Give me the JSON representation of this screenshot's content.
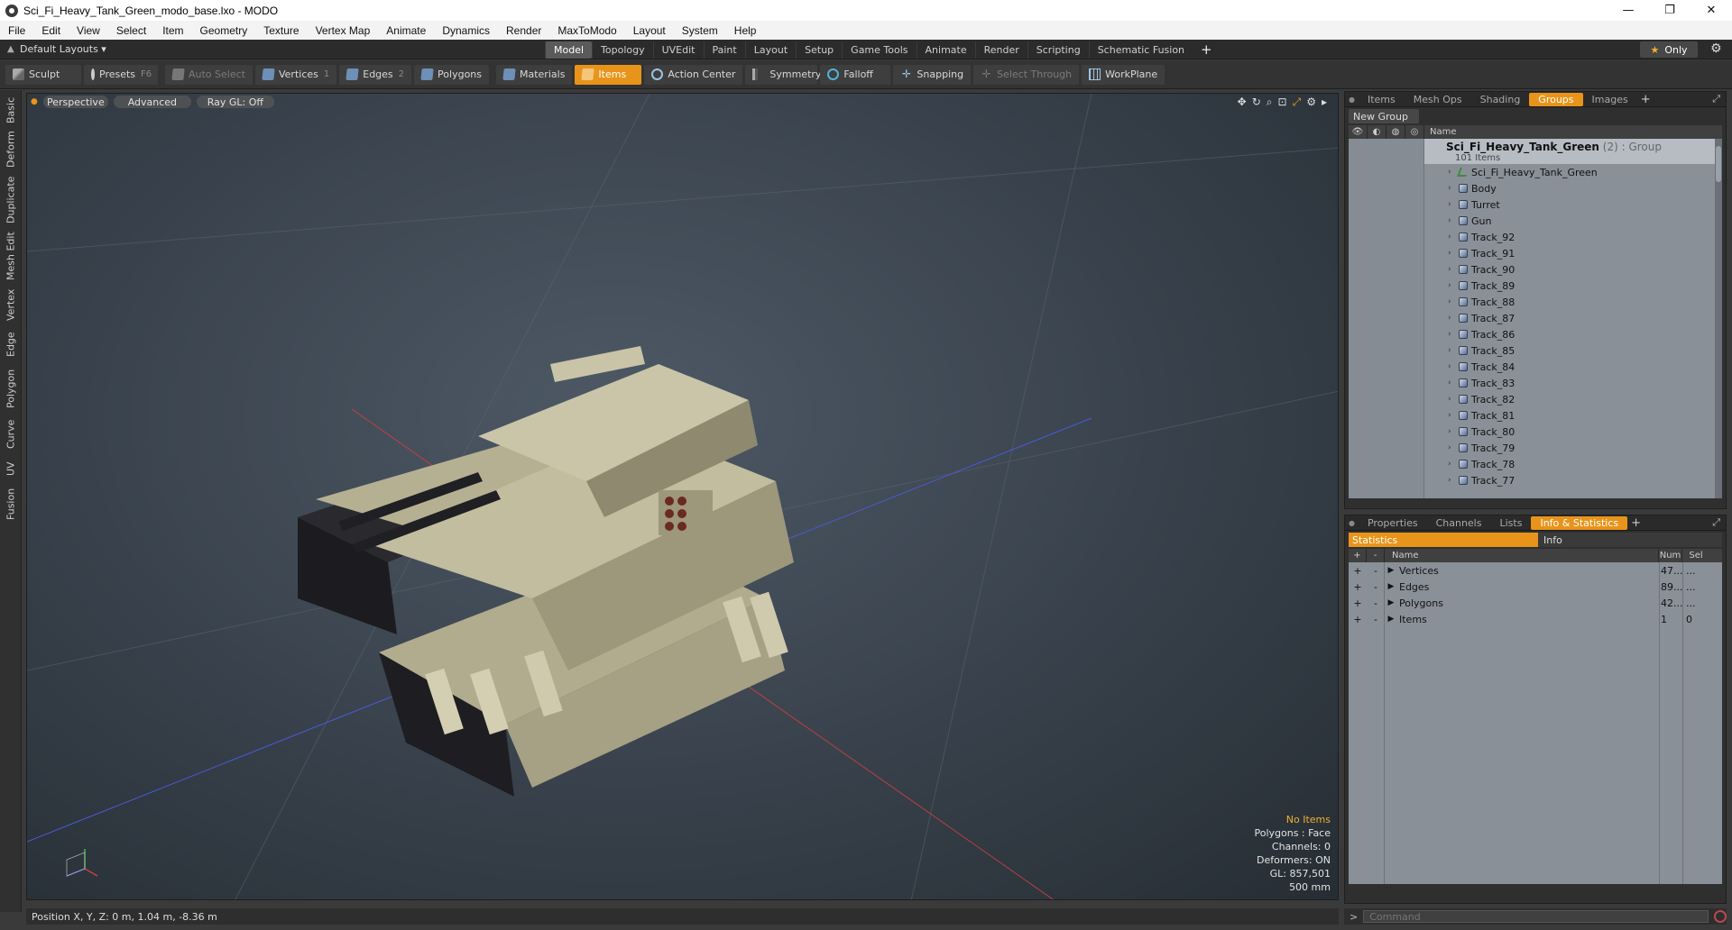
{
  "window": {
    "title": "Sci_Fi_Heavy_Tank_Green_modo_base.lxo - MODO",
    "minimize": "—",
    "maximize": "❐",
    "close": "✕"
  },
  "menu": [
    "File",
    "Edit",
    "View",
    "Select",
    "Item",
    "Geometry",
    "Texture",
    "Vertex Map",
    "Animate",
    "Dynamics",
    "Render",
    "MaxToModo",
    "Layout",
    "System",
    "Help"
  ],
  "modebar": {
    "layout_label": "Default Layouts ▾",
    "tabs": [
      "Model",
      "Topology",
      "UVEdit",
      "Paint",
      "Layout",
      "Setup",
      "Game Tools",
      "Animate",
      "Render",
      "Scripting",
      "Schematic Fusion"
    ],
    "active_tab": "Model",
    "only_label": "Only"
  },
  "toolbar": {
    "sculpt": "Sculpt",
    "presets": "Presets",
    "presets_key": "F6",
    "auto_select": "Auto Select",
    "vertices": "Vertices",
    "vertices_key": "1",
    "edges": "Edges",
    "edges_key": "2",
    "polygons": "Polygons",
    "materials": "Materials",
    "items": "Items",
    "action_center": "Action Center",
    "symmetry": "Symmetry",
    "falloff": "Falloff",
    "snapping": "Snapping",
    "select_through": "Select Through",
    "workplane": "WorkPlane"
  },
  "left_tabs": [
    "Basic",
    "Deform",
    "Duplicate",
    "Mesh Edit",
    "Vertex",
    "Edge",
    "Polygon",
    "Curve",
    "UV",
    "Fusion"
  ],
  "viewport": {
    "perspective": "Perspective",
    "advanced": "Advanced",
    "raygl": "Ray GL: Off",
    "info": {
      "no_items": "No Items",
      "polygons": "Polygons : Face",
      "channels": "Channels: 0",
      "deformers": "Deformers: ON",
      "gl": "GL: 857,501",
      "scale": "500 mm"
    }
  },
  "status": {
    "position": "Position X, Y, Z:  0 m, 1.04 m, -8.36 m"
  },
  "groups_panel": {
    "tabs": [
      "Items",
      "Mesh Ops",
      "Shading",
      "Groups",
      "Images"
    ],
    "active_tab": "Groups",
    "new_group": "New Group",
    "name_header": "Name",
    "root_name": "Sci_Fi_Heavy_Tank_Green",
    "root_suffix": " (2) : Group",
    "root_count": "101 Items",
    "items": [
      "Sci_Fi_Heavy_Tank_Green",
      "Body",
      "Turret",
      "Gun",
      "Track_92",
      "Track_91",
      "Track_90",
      "Track_89",
      "Track_88",
      "Track_87",
      "Track_86",
      "Track_85",
      "Track_84",
      "Track_83",
      "Track_82",
      "Track_81",
      "Track_80",
      "Track_79",
      "Track_78",
      "Track_77"
    ]
  },
  "info_panel": {
    "tabs": [
      "Properties",
      "Channels",
      "Lists",
      "Info & Statistics"
    ],
    "active_tab": "Info & Statistics",
    "sub_statistics": "Statistics",
    "sub_info": "Info",
    "headers": {
      "add": "+",
      "remove": "-",
      "name": "Name",
      "num": "Num",
      "sel": "Sel"
    },
    "rows": [
      {
        "name": "Vertices",
        "num": "47...",
        "sel": "..."
      },
      {
        "name": "Edges",
        "num": "89...",
        "sel": "..."
      },
      {
        "name": "Polygons",
        "num": "42...",
        "sel": "..."
      },
      {
        "name": "Items",
        "num": "1",
        "sel": "0"
      }
    ]
  },
  "command": {
    "prompt": ">",
    "placeholder": "Command"
  },
  "colors": {
    "accent": "#e8941a",
    "axis_x": "#c84040",
    "axis_y": "#40c040",
    "axis_z": "#4060d0",
    "tank_camo": "#bdb89a"
  }
}
